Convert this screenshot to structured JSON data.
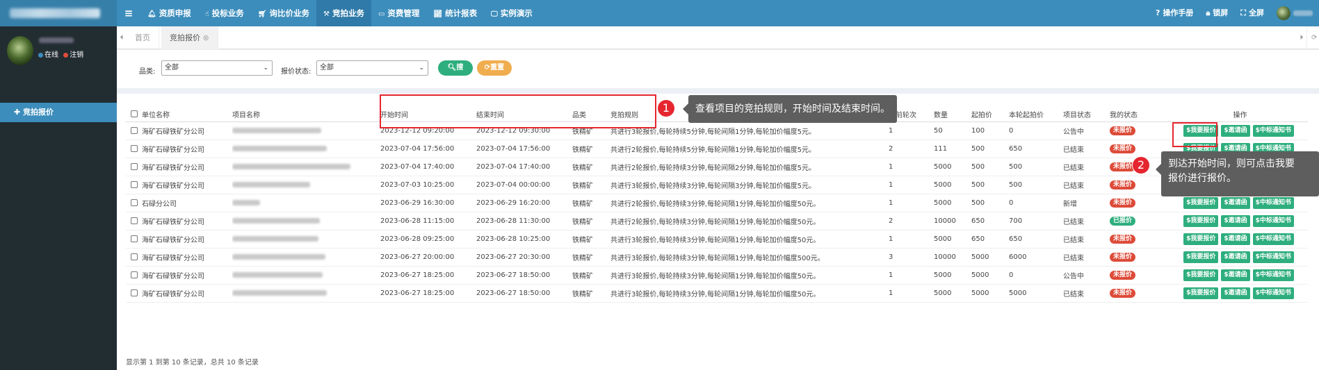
{
  "topbar": {
    "menu": [
      {
        "icon": "bell-icon",
        "glyph": "🔔︎",
        "label": "资质申报"
      },
      {
        "icon": "hand-icon",
        "glyph": "☝︎",
        "label": "投标业务"
      },
      {
        "icon": "cart-icon",
        "glyph": "🛒︎",
        "label": "询比价业务"
      },
      {
        "icon": "gavel-icon",
        "glyph": "⚒︎",
        "label": "竞拍业务"
      },
      {
        "icon": "card-icon",
        "glyph": "▭",
        "label": "资费管理"
      },
      {
        "icon": "chart-icon",
        "glyph": "📈︎",
        "label": "统计报表"
      },
      {
        "icon": "monitor-icon",
        "glyph": "🖵︎",
        "label": "实例演示"
      }
    ],
    "right": [
      {
        "icon": "help-icon",
        "glyph": "?",
        "label": "操作手册"
      },
      {
        "icon": "lock-icon",
        "glyph": "🔒︎",
        "label": "锁屏"
      },
      {
        "icon": "fullscreen-icon",
        "glyph": "⛶",
        "label": "全屏"
      }
    ],
    "colors": {
      "bar": "#3c8dbc",
      "active": "#2f7aa8",
      "logo": "#367fa9"
    }
  },
  "sidebar": {
    "status_online": "在线",
    "status_logout": "注销",
    "menu_item": "✚ 竞拍报价"
  },
  "tabs": [
    {
      "label": "首页"
    },
    {
      "label": "竞拍报价",
      "close": "⊗"
    }
  ],
  "filters": {
    "category_label": "品类:",
    "category_value": "全部",
    "status_label": "报价状态:",
    "status_value": "全部",
    "search_btn": "🔍︎搜索",
    "reset_btn": "⟳重置"
  },
  "table": {
    "headers": [
      "单位名称",
      "项目名称",
      "开始时间",
      "结束时间",
      "品类",
      "竞拍规则",
      "当前轮次",
      "数量",
      "起拍价",
      "本轮起拍价",
      "项目状态",
      "我的状态",
      "操作"
    ],
    "actions": [
      "$我要报价",
      "$邀请函",
      "$中标通知书"
    ],
    "rows": [
      {
        "unit": "海矿石碌铁矿分公司",
        "start": "2023-12-12 09:20:00",
        "end": "2023-12-12 09:30:00",
        "cat": "铁精矿",
        "rule": "共进行3轮报价,每轮持续5分钟,每轮间隔1分钟,每轮加价幅度5元。",
        "round": "1",
        "qty": "50",
        "start_price": "100",
        "round_price": "0",
        "proj_status": "公告中",
        "my_status": "未报价",
        "my_color": "#dd4b39"
      },
      {
        "unit": "海矿石碌铁矿分公司",
        "start": "2023-07-04 17:56:00",
        "end": "2023-07-04 17:56:00",
        "cat": "铁精矿",
        "rule": "共进行2轮报价,每轮持续5分钟,每轮间隔1分钟,每轮加价幅度5元。",
        "round": "2",
        "qty": "111",
        "start_price": "500",
        "round_price": "650",
        "proj_status": "已结束",
        "my_status": "未报价",
        "my_color": "#dd4b39"
      },
      {
        "unit": "海矿石碌铁矿分公司",
        "start": "2023-07-04 17:40:00",
        "end": "2023-07-04 17:40:00",
        "cat": "铁精矿",
        "rule": "共进行2轮报价,每轮持续3分钟,每轮间隔2分钟,每轮加价幅度5元。",
        "round": "1",
        "qty": "5000",
        "start_price": "500",
        "round_price": "500",
        "proj_status": "已结束",
        "my_status": "未报价",
        "my_color": "#dd4b39"
      },
      {
        "unit": "海矿石碌铁矿分公司",
        "start": "2023-07-03 10:25:00",
        "end": "2023-07-04 00:00:00",
        "cat": "铁精矿",
        "rule": "共进行3轮报价,每轮持续3分钟,每轮间隔3分钟,每轮加价幅度5元。",
        "round": "1",
        "qty": "5000",
        "start_price": "500",
        "round_price": "500",
        "proj_status": "已结束",
        "my_status": "未报价",
        "my_color": "#dd4b39"
      },
      {
        "unit": "石碌分公司",
        "start": "2023-06-29 16:30:00",
        "end": "2023-06-29 16:20:00",
        "cat": "铁精矿",
        "rule": "共进行2轮报价,每轮持续3分钟,每轮间隔1分钟,每轮加价幅度50元。",
        "round": "1",
        "qty": "5000",
        "start_price": "500",
        "round_price": "0",
        "proj_status": "新增",
        "my_status": "未报价",
        "my_color": "#dd4b39"
      },
      {
        "unit": "海矿石碌铁矿分公司",
        "start": "2023-06-28 11:15:00",
        "end": "2023-06-28 11:30:00",
        "cat": "铁精矿",
        "rule": "共进行2轮报价,每轮持续3分钟,每轮间隔1分钟,每轮加价幅度50元。",
        "round": "2",
        "qty": "10000",
        "start_price": "650",
        "round_price": "700",
        "proj_status": "已结束",
        "my_status": "已报价",
        "my_color": "#2eae7e"
      },
      {
        "unit": "海矿石碌铁矿分公司",
        "start": "2023-06-28 09:25:00",
        "end": "2023-06-28 10:25:00",
        "cat": "铁精矿",
        "rule": "共进行3轮报价,每轮持续3分钟,每轮间隔1分钟,每轮加价幅度50元。",
        "round": "1",
        "qty": "5000",
        "start_price": "650",
        "round_price": "650",
        "proj_status": "已结束",
        "my_status": "未报价",
        "my_color": "#dd4b39"
      },
      {
        "unit": "海矿石碌铁矿分公司",
        "start": "2023-06-27 20:00:00",
        "end": "2023-06-27 20:30:00",
        "cat": "铁精矿",
        "rule": "共进行3轮报价,每轮持续3分钟,每轮间隔1分钟,每轮加价幅度500元。",
        "round": "3",
        "qty": "10000",
        "start_price": "5000",
        "round_price": "6000",
        "proj_status": "已结束",
        "my_status": "未报价",
        "my_color": "#dd4b39"
      },
      {
        "unit": "海矿石碌铁矿分公司",
        "start": "2023-06-27 18:25:00",
        "end": "2023-06-27 18:50:00",
        "cat": "铁精矿",
        "rule": "共进行3轮报价,每轮持续3分钟,每轮间隔1分钟,每轮加价幅度50元。",
        "round": "1",
        "qty": "5000",
        "start_price": "5000",
        "round_price": "0",
        "proj_status": "公告中",
        "my_status": "未报价",
        "my_color": "#dd4b39"
      },
      {
        "unit": "海矿石碌铁矿分公司",
        "start": "2023-06-27 18:25:00",
        "end": "2023-06-27 18:50:00",
        "cat": "铁精矿",
        "rule": "共进行3轮报价,每轮持续3分钟,每轮间隔1分钟,每轮加价幅度50元。",
        "round": "1",
        "qty": "5000",
        "start_price": "5000",
        "round_price": "5000",
        "proj_status": "已结束",
        "my_status": "未报价",
        "my_color": "#dd4b39"
      }
    ]
  },
  "pager": "显示第 1 到第 10 条记录，总共 10 条记录",
  "annotations": {
    "n1": "1",
    "callout1": "查看项目的竞拍规则，开始时间及结束时间。",
    "n2": "2",
    "callout2_line1": "到达开始时间，则可点击我要",
    "callout2_line2": "报价进行报价。",
    "accent": "#e5262f"
  }
}
